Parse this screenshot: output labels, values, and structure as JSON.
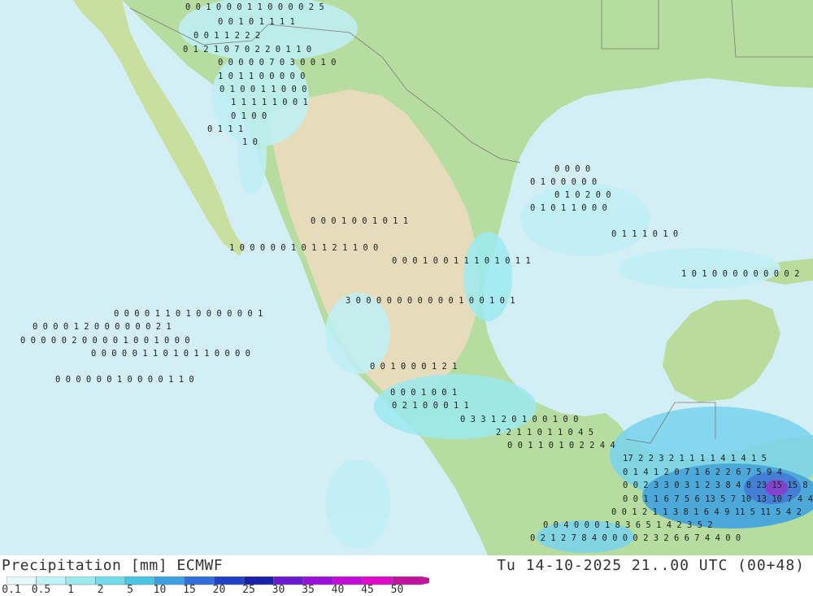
{
  "header": {
    "product_label": "Precipitation [mm] ECMWF",
    "valid_time": "Tu 14-10-2025 21..00 UTC (00+48)"
  },
  "legend": {
    "classes": [
      {
        "value": "0.1",
        "color": "#e6fbff"
      },
      {
        "value": "0.5",
        "color": "#bff3f8"
      },
      {
        "value": "1",
        "color": "#9ceaf0"
      },
      {
        "value": "2",
        "color": "#73dbe9"
      },
      {
        "value": "5",
        "color": "#4cc4e6"
      },
      {
        "value": "10",
        "color": "#3aa0e3"
      },
      {
        "value": "15",
        "color": "#2f6fde"
      },
      {
        "value": "20",
        "color": "#2240c6"
      },
      {
        "value": "25",
        "color": "#1820a8"
      },
      {
        "value": "30",
        "color": "#6a1bd0"
      },
      {
        "value": "35",
        "color": "#9a10d8"
      },
      {
        "value": "40",
        "color": "#c40ad8"
      },
      {
        "value": "45",
        "color": "#e10ac8"
      },
      {
        "value": "50",
        "color": "#c0159a"
      }
    ]
  },
  "colors": {
    "ocean": "#d4eef5",
    "land_low": "#a8d69a",
    "land_mid": "#c9e1a6",
    "land_high": "#e3d9b6",
    "precip_light": "#bff0f6",
    "precip_med": "#78d3ee",
    "precip_heavy": "#3a7fe0",
    "precip_extreme": "#7a2ad6"
  },
  "map_values": [
    {
      "row": 1,
      "text": "0 0 1 0 0   0 1 1 0 0   0 0 2 5"
    },
    {
      "row": 2,
      "text": "0   0 1 0 1 1   1 1"
    },
    {
      "row": 3,
      "text": "0   0 1 1 2   2 2"
    },
    {
      "row": 4,
      "text": "0 1 2   1   0 7 0 2 2 0 1 1 0"
    },
    {
      "row": 5,
      "text": "0 0 0 0 0 7 0 3   0 0 1   0"
    },
    {
      "row": 6,
      "text": "1 0 1 1 0 0 0   0   0"
    },
    {
      "row": 7,
      "text": "0 1 0 0 1 1 0 0 0"
    },
    {
      "row": 8,
      "text": "1 1 1 1 1 0 0 1"
    },
    {
      "row": 9,
      "text": "0 1 0 0"
    },
    {
      "row": 10,
      "text": "0   1 1 1"
    },
    {
      "row": 11,
      "text": "1 0"
    },
    {
      "row": 12,
      "text": "0 0 0 0"
    },
    {
      "row": 13,
      "text": "0   1 0 0 0 0 0"
    },
    {
      "row": 14,
      "text": "0 1 0 2 0 0"
    },
    {
      "row": 15,
      "text": "0   1 0 1 1 0 0 0"
    },
    {
      "row": 16,
      "text": "0 0   0   1 0 0 1 0 1 1"
    },
    {
      "row": 17,
      "text": "0 1 1 1 0 1 0"
    },
    {
      "row": 18,
      "text": "1 0   0   0 0 0 1   0   1 1 2 1 1 0 0"
    },
    {
      "row": 19,
      "text": "0   0   0   1 0   0 1 1 1 0 1 0 1   1"
    },
    {
      "row": 20,
      "text": "1   0 1 0 0 0 0 0 0 0 0 2"
    },
    {
      "row": 21,
      "text": "3 0   0   0 0   0 0 0 0   0 0 1   0 0 1 0 1"
    },
    {
      "row": 22,
      "text": "0 0 0 0   1 1   0 1 0 0   0 0   0 0 1"
    },
    {
      "row": 23,
      "text": "0   0 0 0   1 2 0   0 0 0   0 0   2 1"
    },
    {
      "row": 24,
      "text": "0 0   0 0 0   2 0 0   0 0 1 0   0 1 0 0 0"
    },
    {
      "row": 25,
      "text": "0   0 0 0 0   1 1 0 1 0   1 1   0   0 0 0"
    },
    {
      "row": 26,
      "text": "0 0 1 0 0   0 1   2 1"
    },
    {
      "row": 27,
      "text": "0 0 0 0 0 0   1 0 0 0 0   1 1   0"
    },
    {
      "row": 28,
      "text": "0 0 0 1   0 0 1"
    },
    {
      "row": 29,
      "text": "0 2 1 0 0   0 1 1"
    },
    {
      "row": 30,
      "text": "0 3 3 1 2   0   1 0   0 1 0 0"
    },
    {
      "row": 31,
      "text": "2 2 1 1   0 1 1 0   4 5"
    },
    {
      "row": 32,
      "text": "0 0 1 1 0   1   0 2   2   4 4"
    },
    {
      "row": 33,
      "text": "17 2 2 3 2 1 1 1 1   4 1 4 1 5"
    },
    {
      "row": 34,
      "text": "0 1 4 1 2 0 7 1 6 2   2 6 7 5 9 4"
    },
    {
      "row": 35,
      "text": "0 0 2 3 3 0 3 1 2 3 8 4 8 23 15 15 8 6"
    },
    {
      "row": 36,
      "text": "0 0 1 1 6 7 5 6 13 5 7 10 13 10 7 4 4"
    },
    {
      "row": 37,
      "text": "0 0 1 2 1 1 3 8 1 6 4 9 11 5 11 5 4 2"
    },
    {
      "row": 38,
      "text": "0 0   4 0 0 0   1 8 3 6 5 1 4 2 3 5 2"
    },
    {
      "row": 39,
      "text": "0 2 1 2 7 8 4 0   0 0 0 2 3 2 6 6 7 4 4 0 0"
    }
  ]
}
